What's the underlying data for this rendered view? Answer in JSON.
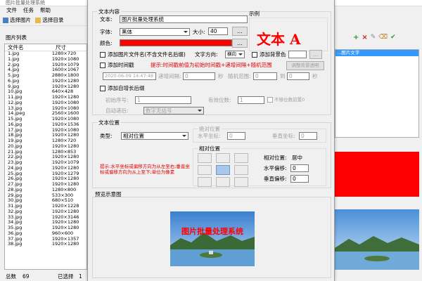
{
  "window": {
    "title": "图片批量处理系统"
  },
  "menu": [
    "文件",
    "任务",
    "帮助"
  ],
  "toolbar": {
    "add_image": "选择图片",
    "add_folder": "选择目录",
    "add_task": "添加任务"
  },
  "file_list": {
    "title": "图片列表",
    "col_name": "文件名",
    "col_size": "尺寸",
    "rows": [
      [
        "1.jpg",
        "1280×720"
      ],
      [
        "1.jpg",
        "1920×1080"
      ],
      [
        "2.jpg",
        "1920×1079"
      ],
      [
        "4.jpg",
        "1600×1067"
      ],
      [
        "5.jpg",
        "2880×1800"
      ],
      [
        "6.jpg",
        "1920×1280"
      ],
      [
        "9.jpg",
        "1920×1280"
      ],
      [
        "10.jpg",
        "640×428"
      ],
      [
        "11.jpg",
        "1920×1280"
      ],
      [
        "12.jpg",
        "1920×1080"
      ],
      [
        "13.jpg",
        "1920×1080"
      ],
      [
        "14.jpeg",
        "2560×1600"
      ],
      [
        "15.jpg",
        "1920×1080"
      ],
      [
        "16.jpg",
        "1920×1536"
      ],
      [
        "17.jpg",
        "1920×1080"
      ],
      [
        "18.jpg",
        "1920×1280"
      ],
      [
        "19.jpg",
        "1280×720"
      ],
      [
        "20.jpg",
        "1920×1280"
      ],
      [
        "21.jpg",
        "1280×853"
      ],
      [
        "22.jpg",
        "1920×1280"
      ],
      [
        "23.jpg",
        "1920×1079"
      ],
      [
        "24.jpg",
        "1920×1280"
      ],
      [
        "25.jpg",
        "1920×1279"
      ],
      [
        "26.jpg",
        "1920×1280"
      ],
      [
        "27.jpg",
        "1920×1280"
      ],
      [
        "28.jpg",
        "1280×800"
      ],
      [
        "29.jpg",
        "533×300"
      ],
      [
        "30.jpg",
        "680×510"
      ],
      [
        "31.jpg",
        "1920×1228"
      ],
      [
        "32.jpg",
        "1920×1280"
      ],
      [
        "33.jpg",
        "1920×3146"
      ],
      [
        "34.jpg",
        "1920×1280"
      ],
      [
        "35.jpg",
        "1920×1280"
      ],
      [
        "36.jpg",
        "960×600"
      ],
      [
        "37.jpg",
        "1920×1357"
      ],
      [
        "38.jpg",
        "1920×1280"
      ]
    ]
  },
  "status": {
    "total_label": "总数",
    "total": "69",
    "selected_label": "已选择",
    "selected": "1"
  },
  "text_content": {
    "group": "文本内容",
    "text_label": "文本:",
    "text_value": "图片批量处理系统",
    "font_label": "字体:",
    "font_value": "黑体",
    "size_label": "大小:",
    "size_value": "40",
    "more": "...",
    "color_label": "颜色:",
    "color": "#ff0000",
    "add_filename": "添加图片文件名(不含文件名后缀)",
    "direction_label": "文字方向:",
    "direction_value": "横向",
    "add_bg": "添加背景色",
    "bg_more": "...",
    "bg_opacity": "调整背景透明",
    "add_time": "添加时间戳",
    "time_hint": "提示:时间戳前值为初始时间戳+递增间隔+随机范围",
    "time_value": "2020-06-09 14:47:48",
    "interval_label": "递增间隔:",
    "interval_value": "0",
    "sec1": "秒",
    "random_label": "随机范围:",
    "random_value": "0",
    "to": "到",
    "random_to": "0",
    "sec2": "秒",
    "add_increment": "添加自增长后缀",
    "start_label": "初始序号:",
    "start_value": "1",
    "digits_label": "有效位数:",
    "digits_value": "1",
    "no_fill": "不够位数前置0",
    "mode_label": "自动递后:",
    "mode_value": "数字无括号"
  },
  "example": {
    "label": "示例",
    "text": "文本 A",
    "color": "#ff0000"
  },
  "text_position": {
    "group": "文本位置",
    "type_label": "类型:",
    "type_value": "相对位置",
    "abs_group": "绝对位置",
    "h_label": "水平坐标:",
    "h_value": "0",
    "v_label": "垂直坐标:",
    "v_value": "0",
    "rel_group": "相对位置",
    "rel_pos_label": "相对位置:",
    "rel_pos_value": "居中",
    "h_off_label": "水平偏移:",
    "h_off_value": "0",
    "v_off_label": "垂直偏移:",
    "v_off_value": "0",
    "hint": "提示:水平坐标或偏移方向为从左至右;垂直坐标或偏移方向为从上至下;单位为像素"
  },
  "preview": {
    "label": "预览示意图",
    "overlay_text": "图片批量处理系统"
  },
  "right_panel": {
    "selected_item": "...图片文字"
  }
}
